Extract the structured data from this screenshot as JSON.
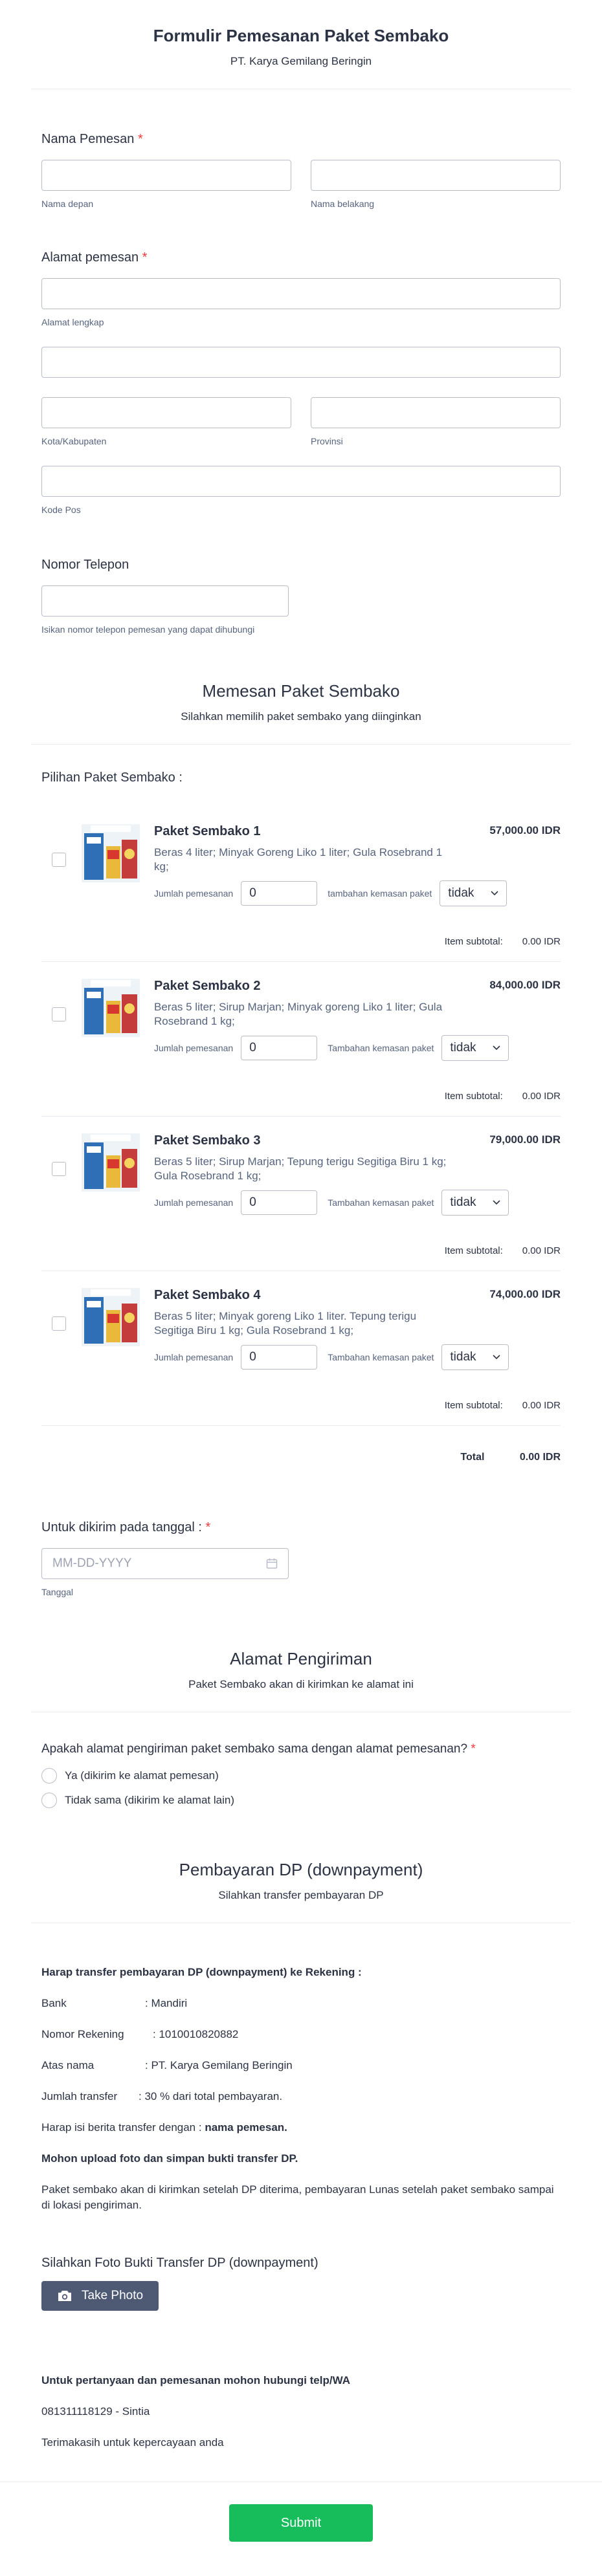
{
  "header": {
    "title": "Formulir Pemesanan Paket Sembako",
    "subtitle": "PT. Karya Gemilang Beringin"
  },
  "name_field": {
    "label": "Nama Pemesan",
    "required": "*",
    "first_sub": "Nama depan",
    "last_sub": "Nama belakang"
  },
  "address_field": {
    "label": "Alamat pemesan",
    "required": "*",
    "street_sub": "Alamat lengkap",
    "city_sub": "Kota/Kabupaten",
    "province_sub": "Provinsi",
    "zip_sub": "Kode Pos"
  },
  "phone_field": {
    "label": "Nomor Telepon",
    "sub": "Isikan nomor telepon pemesan yang dapat dihubungi"
  },
  "order_section": {
    "title": "Memesan Paket Sembako",
    "subtitle": "Silahkan memilih paket sembako yang diinginkan",
    "pick_label": "Pilihan Paket Sembako :"
  },
  "products": [
    {
      "name": "Paket Sembako 1",
      "price": "57,000.00",
      "currency": "IDR",
      "desc": "Beras 4 liter; Minyak Goreng Liko 1 liter; Gula Rosebrand 1 kg;",
      "qty_label": "Jumlah pemesanan",
      "qty": "0",
      "pack_label": "tambahan kemasan paket",
      "pack_value": "tidak",
      "subtotal_label": "Item subtotal:",
      "subtotal": "0.00 IDR"
    },
    {
      "name": "Paket Sembako 2",
      "price": "84,000.00",
      "currency": "IDR",
      "desc": "Beras 5 liter; Sirup Marjan; Minyak goreng Liko 1 liter; Gula Rosebrand 1 kg;",
      "qty_label": "Jumlah pemesanan",
      "qty": "0",
      "pack_label": "Tambahan kemasan paket",
      "pack_value": "tidak",
      "subtotal_label": "Item subtotal:",
      "subtotal": "0.00 IDR"
    },
    {
      "name": "Paket Sembako 3",
      "price": "79,000.00",
      "currency": "IDR",
      "desc": "Beras 5 liter; Sirup Marjan; Tepung terigu Segitiga Biru 1 kg; Gula Rosebrand 1 kg;",
      "qty_label": "Jumlah pemesanan",
      "qty": "0",
      "pack_label": "Tambahan kemasan paket",
      "pack_value": "tidak",
      "subtotal_label": "Item subtotal:",
      "subtotal": "0.00 IDR"
    },
    {
      "name": "Paket Sembako 4",
      "price": "74,000.00",
      "currency": "IDR",
      "desc": "Beras 5 liter; Minyak goreng Liko 1 liter. Tepung terigu Segitiga Biru 1 kg; Gula Rosebrand 1 kg;",
      "qty_label": "Jumlah pemesanan",
      "qty": "0",
      "pack_label": "Tambahan kemasan paket",
      "pack_value": "tidak",
      "subtotal_label": "Item subtotal:",
      "subtotal": "0.00 IDR"
    }
  ],
  "total": {
    "label": "Total",
    "value": "0.00 IDR"
  },
  "date_field": {
    "label": "Untuk dikirim pada tanggal :",
    "required": "*",
    "placeholder": "MM-DD-YYYY",
    "sub": "Tanggal"
  },
  "shipping_section": {
    "title": "Alamat Pengiriman",
    "subtitle": "Paket Sembako akan di kirimkan ke alamat ini"
  },
  "same_address": {
    "label": "Apakah alamat pengiriman paket sembako sama dengan alamat pemesanan?",
    "required": "*",
    "options": [
      "Ya (dikirim ke alamat pemesan)",
      "Tidak sama (dikirim ke alamat lain)"
    ]
  },
  "payment_section": {
    "title": "Pembayaran DP (downpayment)",
    "subtitle": "Silahkan transfer pembayaran DP"
  },
  "payment_info": {
    "heading": "Harap transfer pembayaran DP (downpayment) ke Rekening :",
    "bank_label": "Bank",
    "bank_value": ": Mandiri",
    "account_label": "Nomor Rekening",
    "account_value": ": 1010010820882",
    "name_label": "Atas nama",
    "name_value": ": PT. Karya Gemilang Beringin",
    "amount_label": "Jumlah transfer",
    "amount_value": ": 30 % dari total pembayaran.",
    "note_prefix": "Harap isi berita transfer dengan :",
    "note_bold": "nama pemesan.",
    "upload_note": "Mohon upload foto dan simpan bukti transfer DP.",
    "delivery_note": "Paket sembako akan di kirimkan setelah DP diterima, pembayaran Lunas setelah paket sembako sampai di lokasi pengiriman."
  },
  "photo_field": {
    "label": "Silahkan Foto Bukti Transfer DP (downpayment)",
    "button": "Take Photo"
  },
  "contact": {
    "heading": "Untuk pertanyaan dan pemesanan mohon hubungi telp/WA",
    "phone": "081311118129 - Sintia",
    "thanks": "Terimakasih untuk kepercayaan anda"
  },
  "submit": "Submit"
}
